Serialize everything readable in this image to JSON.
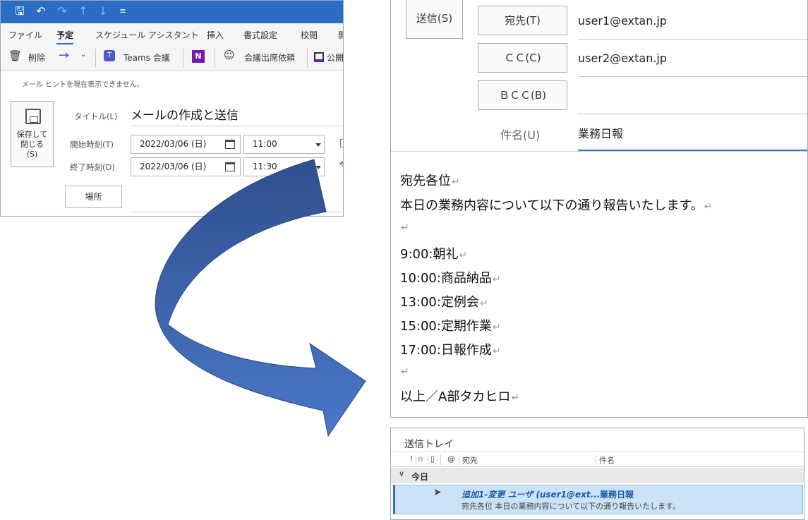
{
  "appointment": {
    "quick_access": {
      "save_icon": "save-icon",
      "undo_icon": "undo-icon",
      "redo_icon": "redo-icon",
      "up_icon": "arrow-up-icon",
      "down_icon": "arrow-down-icon",
      "customize_icon": "customize-icon"
    },
    "tabs": [
      "ファイル",
      "予定",
      "スケジュール アシスタント",
      "挿入",
      "書式設定",
      "校閲",
      "開"
    ],
    "active_tab": "予定",
    "ribbon": {
      "delete": "削除",
      "teams": "Teams 会議",
      "attendees": "会議出席依頼",
      "public": "公開"
    },
    "hint": "メール ヒントを現在表示できません。",
    "save_close": [
      "保存して",
      "閉じる",
      "(S)"
    ],
    "title_label": "タイトル(L)",
    "title_value": "メールの作成と送信",
    "start_label": "開始時刻(T)",
    "end_label": "終了時刻(D)",
    "start_date": "2022/03/06 (日)",
    "start_time": "11:00",
    "end_date": "2022/03/06 (日)",
    "end_time": "11:30",
    "location_button": "場所"
  },
  "mail": {
    "send_button": "送信(S)",
    "to_button": "宛先(T)",
    "cc_button": "ＣＣ(C)",
    "bcc_button": "ＢＣＣ(B)",
    "to_value": "user1@extan.jp",
    "cc_value": "user2@extan.jp",
    "bcc_value": "",
    "subject_label": "件名(U)",
    "subject_value": "業務日報",
    "body": [
      "宛先各位",
      "本日の業務内容について以下の通り報告いたします。",
      "",
      "9:00:朝礼",
      "10:00:商品納品",
      "13:00:定例会",
      "15:00:定期作業",
      "17:00:日報作成",
      "",
      "以上／A部タカヒロ"
    ]
  },
  "outbox": {
    "title": "送信トレイ",
    "columns": [
      "!",
      "宛先",
      "件名"
    ],
    "group": "今日",
    "item": {
      "from": "追加1-変更 ユーザ (user1@ext...",
      "subject": "業務日報",
      "preview": "宛先各位  本日の業務内容について以下の通り報告いたします。"
    }
  },
  "colors": {
    "accent": "#2b6cc4",
    "arrow_dark": "#2f4f8f",
    "arrow_light": "#4a78c8",
    "selection": "#cce3f7"
  }
}
